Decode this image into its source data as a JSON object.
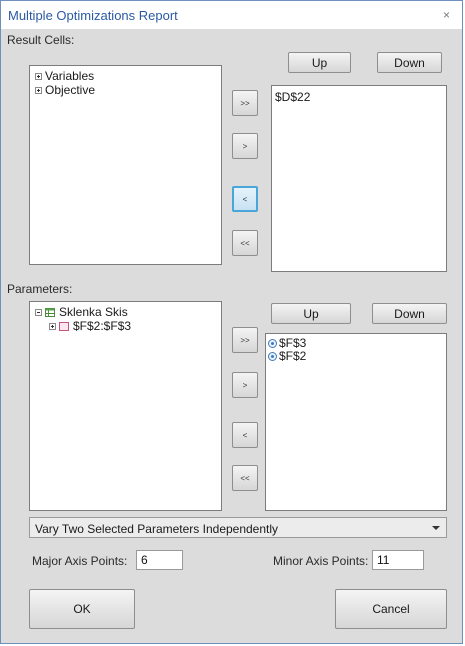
{
  "window": {
    "title": "Multiple Optimizations Report",
    "close_glyph": "×"
  },
  "result_cells": {
    "label": "Result Cells:",
    "tree": [
      {
        "label": "Variables"
      },
      {
        "label": "Objective"
      }
    ],
    "selected": [
      "$D$22"
    ],
    "up_label": "Up",
    "down_label": "Down"
  },
  "transfer_buttons": {
    "add_all": ">>",
    "add": ">",
    "remove": "<",
    "remove_all": "<<"
  },
  "parameters": {
    "label": "Parameters:",
    "tree_root": "Sklenka Skis",
    "tree_child": "$F$2:$F$3",
    "selected": [
      "$F$3",
      "$F$2"
    ],
    "up_label": "Up",
    "down_label": "Down"
  },
  "mode_select": {
    "value": "Vary Two Selected Parameters Independently"
  },
  "major_axis": {
    "label": "Major Axis Points:",
    "value": "6"
  },
  "minor_axis": {
    "label": "Minor Axis Points:",
    "value": "11"
  },
  "footer": {
    "ok_label": "OK",
    "cancel_label": "Cancel"
  },
  "colors": {
    "title_text": "#2b5aa3",
    "dialog_bg": "#dcdcdc",
    "pressed_border": "#4aa6d8"
  }
}
